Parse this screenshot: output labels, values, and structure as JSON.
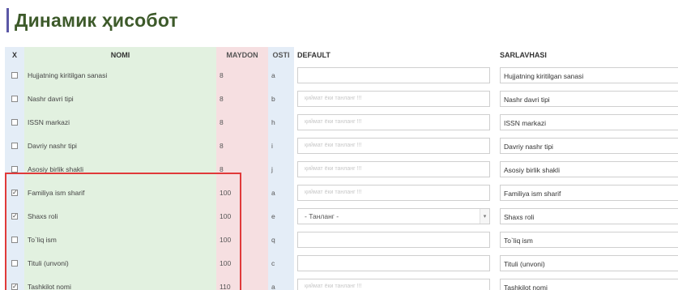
{
  "page_title": "Динамик ҳисобот",
  "columns": {
    "x": "X",
    "nomi": "NOMI",
    "maydon": "MAYDON",
    "osti": "OSTI",
    "default": "DEFAULT",
    "sarlavhasi": "SARLAVHASI"
  },
  "placeholder": "қиймат ёки танланг !!!",
  "rows": [
    {
      "checked": false,
      "nomi": "Hujjatning kiritilgan sanasi",
      "maydon": "8",
      "osti": "a",
      "default_type": "input-empty",
      "sarlavha": "Hujjatning kiritilgan sanasi"
    },
    {
      "checked": false,
      "nomi": "Nashr davri tipi",
      "maydon": "8",
      "osti": "b",
      "default_type": "input-placeholder",
      "sarlavha": "Nashr davri tipi"
    },
    {
      "checked": false,
      "nomi": "ISSN markazi",
      "maydon": "8",
      "osti": "h",
      "default_type": "input-placeholder",
      "sarlavha": "ISSN markazi"
    },
    {
      "checked": false,
      "nomi": "Davriy nashr tipi",
      "maydon": "8",
      "osti": "i",
      "default_type": "input-placeholder",
      "sarlavha": "Davriy nashr tipi"
    },
    {
      "checked": false,
      "nomi": "Asosiy birlik shakli",
      "maydon": "8",
      "osti": "j",
      "default_type": "input-placeholder",
      "sarlavha": "Asosiy birlik shakli"
    },
    {
      "checked": true,
      "nomi": "Familiya ism sharif",
      "maydon": "100",
      "osti": "a",
      "default_type": "input-placeholder",
      "sarlavha": "Familiya ism sharif"
    },
    {
      "checked": true,
      "nomi": "Shaxs roli",
      "maydon": "100",
      "osti": "e",
      "default_type": "select",
      "select_value": "- Танланг -",
      "sarlavha": "Shaxs roli"
    },
    {
      "checked": false,
      "nomi": "To`liq ism",
      "maydon": "100",
      "osti": "q",
      "default_type": "input-empty",
      "sarlavha": "To`liq ism"
    },
    {
      "checked": false,
      "nomi": "Tituli (unvoni)",
      "maydon": "100",
      "osti": "c",
      "default_type": "input-empty",
      "sarlavha": "Tituli (unvoni)"
    },
    {
      "checked": true,
      "nomi": "Tashkilot nomi",
      "maydon": "110",
      "osti": "a",
      "default_type": "input-placeholder",
      "sarlavha": "Tashkilot nomi"
    }
  ],
  "colors": {
    "title": "#3d5a2a",
    "accent_bar": "#5b57a6",
    "highlight": "#e03a3a",
    "col_green": "#e2f1e0",
    "col_pink": "#f6dfe1",
    "col_blue": "#e4edf7"
  }
}
